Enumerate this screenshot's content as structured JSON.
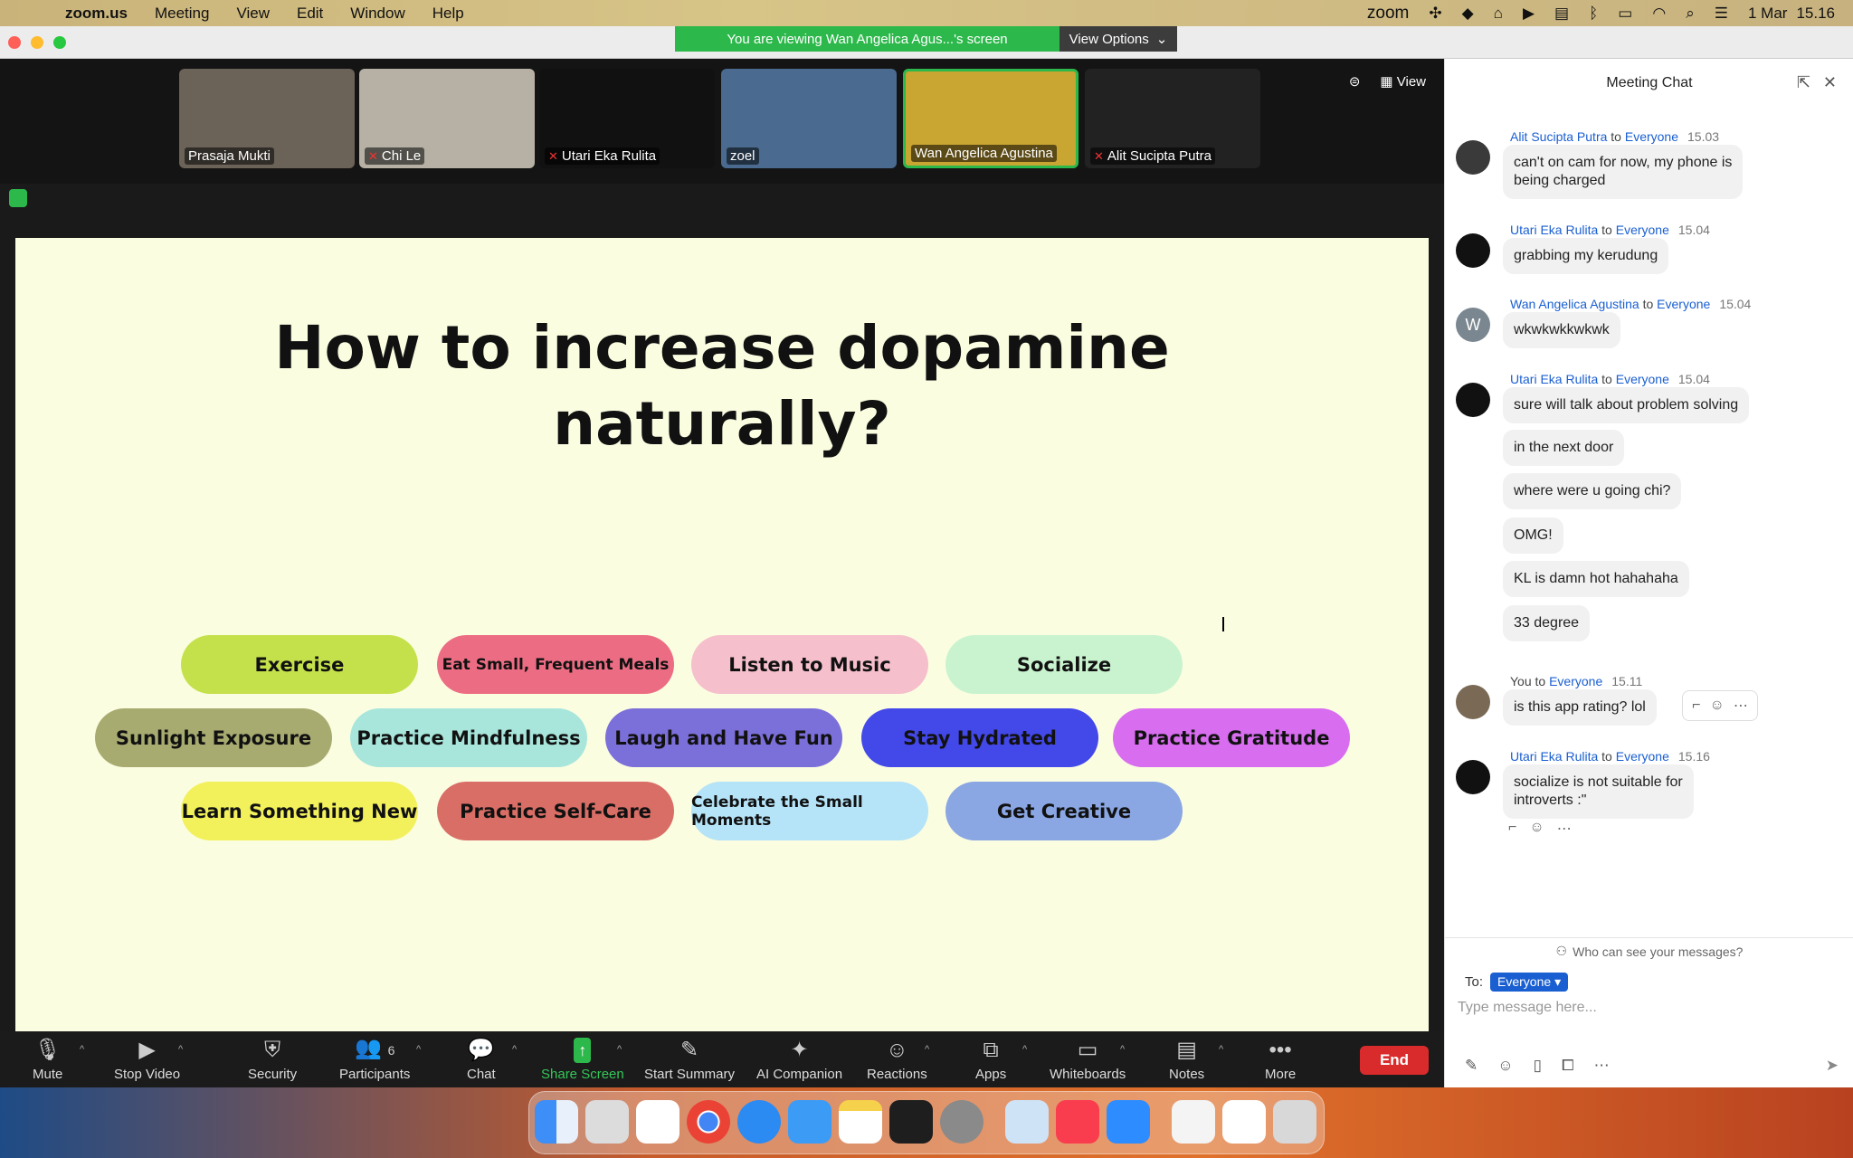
{
  "menubar": {
    "app": "zoom.us",
    "items": [
      "Meeting",
      "View",
      "Edit",
      "Window",
      "Help"
    ],
    "status_zoom": "zoom",
    "date": "1 Mar",
    "time": "15.16"
  },
  "banner": {
    "viewing": "You are viewing Wan Angelica Agus...'s screen",
    "options": "View Options"
  },
  "participants": [
    {
      "name": "Prasaja Mukti",
      "muted": false,
      "color": "#6b6258"
    },
    {
      "name": "Chi Le",
      "muted": true,
      "color": "#b7b1a5"
    },
    {
      "name": "Utari Eka Rulita",
      "muted": true,
      "color": "#111111"
    },
    {
      "name": "zoel",
      "muted": false,
      "color": "#4a6a8f"
    },
    {
      "name": "Wan Angelica Agustina",
      "muted": false,
      "color": "#c9a531"
    },
    {
      "name": "Alit Sucipta Putra",
      "muted": true,
      "color": "#222222"
    }
  ],
  "strip_controls": {
    "view": "View"
  },
  "slide": {
    "title_line1": "How to increase dopamine",
    "title_line2": "naturally?",
    "pills": [
      {
        "label": "Exercise",
        "bg": "#c4e14c"
      },
      {
        "label": "Eat Small, Frequent Meals",
        "bg": "#ec6d83"
      },
      {
        "label": "Listen to Music",
        "bg": "#f5bfcc"
      },
      {
        "label": "Socialize",
        "bg": "#c9f3cf"
      },
      {
        "label": "Sunlight Exposure",
        "bg": "#a8ab70"
      },
      {
        "label": "Practice Mindfulness",
        "bg": "#a8e6dc"
      },
      {
        "label": "Laugh and Have Fun",
        "bg": "#7b6fd9"
      },
      {
        "label": "Stay Hydrated",
        "bg": "#4348e8"
      },
      {
        "label": "Practice Gratitude",
        "bg": "#d86df0"
      },
      {
        "label": "Learn Something New",
        "bg": "#f2f15c"
      },
      {
        "label": "Practice Self-Care",
        "bg": "#d96e66"
      },
      {
        "label": "Celebrate the Small Moments",
        "bg": "#b5e3f7"
      },
      {
        "label": "Get Creative",
        "bg": "#8aa6e3"
      }
    ]
  },
  "toolbar": {
    "mute": "Mute",
    "stop_video": "Stop Video",
    "security": "Security",
    "participants": "Participants",
    "participants_count": "6",
    "chat": "Chat",
    "share": "Share Screen",
    "summary": "Start Summary",
    "ai": "AI Companion",
    "reactions": "Reactions",
    "apps": "Apps",
    "whiteboards": "Whiteboards",
    "notes": "Notes",
    "more": "More",
    "end": "End"
  },
  "chat": {
    "title": "Meeting Chat",
    "to_word": "to",
    "messages": [
      {
        "sender": "Alit Sucipta Putra",
        "to": "Everyone",
        "time": "15.03",
        "lines": [
          "can't on cam for now, my phone is",
          "being charged"
        ]
      },
      {
        "sender": "Utari Eka Rulita",
        "to": "Everyone",
        "time": "15.04",
        "lines": [
          "grabbing my kerudung"
        ]
      },
      {
        "sender": "Wan Angelica Agustina",
        "to": "Everyone",
        "time": "15.04",
        "lines": [
          "wkwkwkkwkwk"
        ],
        "avatar_letter": "W"
      },
      {
        "sender": "Utari Eka Rulita",
        "to": "Everyone",
        "time": "15.04",
        "lines": [
          "sure will talk about problem solving"
        ]
      },
      {
        "lines": [
          "in the next door"
        ]
      },
      {
        "lines": [
          "where were u going chi?"
        ]
      },
      {
        "lines": [
          "OMG!"
        ]
      },
      {
        "lines": [
          "KL is damn hot hahahaha"
        ]
      },
      {
        "lines": [
          "33 degree"
        ]
      },
      {
        "sender": "You",
        "to": "Everyone",
        "time": "15.11",
        "lines": [
          "is this app rating? lol"
        ]
      },
      {
        "sender": "Utari Eka Rulita",
        "to": "Everyone",
        "time": "15.16",
        "lines": [
          "socialize is not suitable for",
          "introverts :\""
        ]
      }
    ],
    "who_can_see": "Who can see your messages?",
    "to_label": "To:",
    "recipient": "Everyone",
    "placeholder": "Type message here..."
  }
}
